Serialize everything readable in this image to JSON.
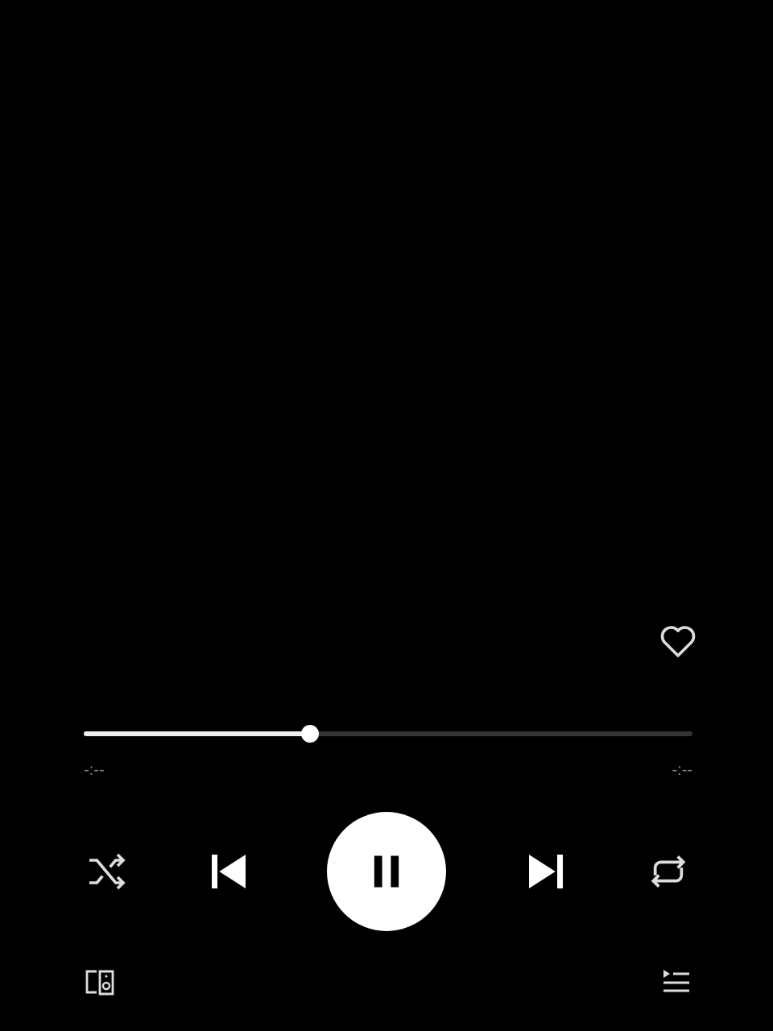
{
  "liked": false,
  "progress": {
    "level": 0.37
  },
  "elapsed": "-:--",
  "remaining": "-:--",
  "playing": true
}
